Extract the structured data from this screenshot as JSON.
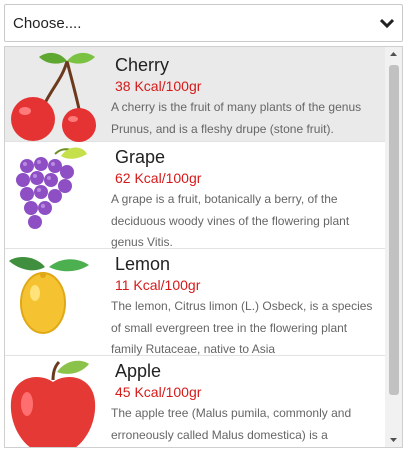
{
  "select": {
    "value": "Choose...."
  },
  "items": [
    {
      "name": "Cherry",
      "kcal": "38 Kcal/100gr",
      "desc": "A cherry is the fruit of many plants of the genus Prunus, and is a fleshy drupe (stone fruit).",
      "icon": "cherry-icon",
      "selected": true
    },
    {
      "name": "Grape",
      "kcal": "62 Kcal/100gr",
      "desc": "A grape is a fruit, botanically a berry, of the deciduous woody vines of the flowering plant genus Vitis.",
      "icon": "grape-icon",
      "selected": false
    },
    {
      "name": "Lemon",
      "kcal": "11 Kcal/100gr",
      "desc": "The lemon, Citrus limon (L.) Osbeck, is a species of small evergreen tree in the flowering plant family Rutaceae, native to Asia",
      "icon": "lemon-icon",
      "selected": false
    },
    {
      "name": "Apple",
      "kcal": "45 Kcal/100gr",
      "desc": "The apple tree (Malus pumila, commonly and erroneously called Malus domestica) is a",
      "icon": "apple-icon",
      "selected": false
    }
  ],
  "colors": {
    "accent_kcal": "#d61a1a",
    "selected_row": "#eaeaea"
  }
}
